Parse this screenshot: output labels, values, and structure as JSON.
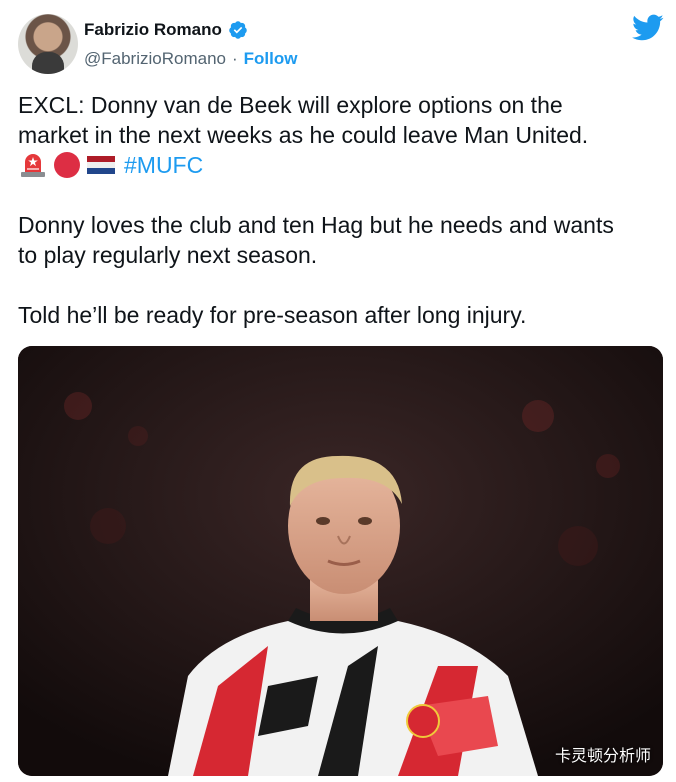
{
  "author": {
    "name": "Fabrizio Romano",
    "handle": "@FabrizioRomano",
    "separator": "·",
    "follow_label": "Follow",
    "avatar_icon": "avatar-photo",
    "verified_icon": "verified-badge-icon"
  },
  "brand": {
    "logo_icon": "twitter-bird-icon",
    "color": "#1d9bf0"
  },
  "tweet": {
    "line1": "EXCL: Donny van de Beek will explore options on the",
    "line2": "market in the next weeks as he could leave Man United.",
    "emojis": [
      "police-light-icon",
      "red-circle-icon",
      "netherlands-flag-icon"
    ],
    "hashtag": "#MUFC",
    "line3": "Donny loves the club and ten Hag but he needs and wants",
    "line4": "to play regularly next season.",
    "line5": "Told he’ll be ready for pre-season after long injury."
  },
  "media": {
    "description_icon": "player-photo",
    "watermark": "卡灵顿分析师"
  }
}
